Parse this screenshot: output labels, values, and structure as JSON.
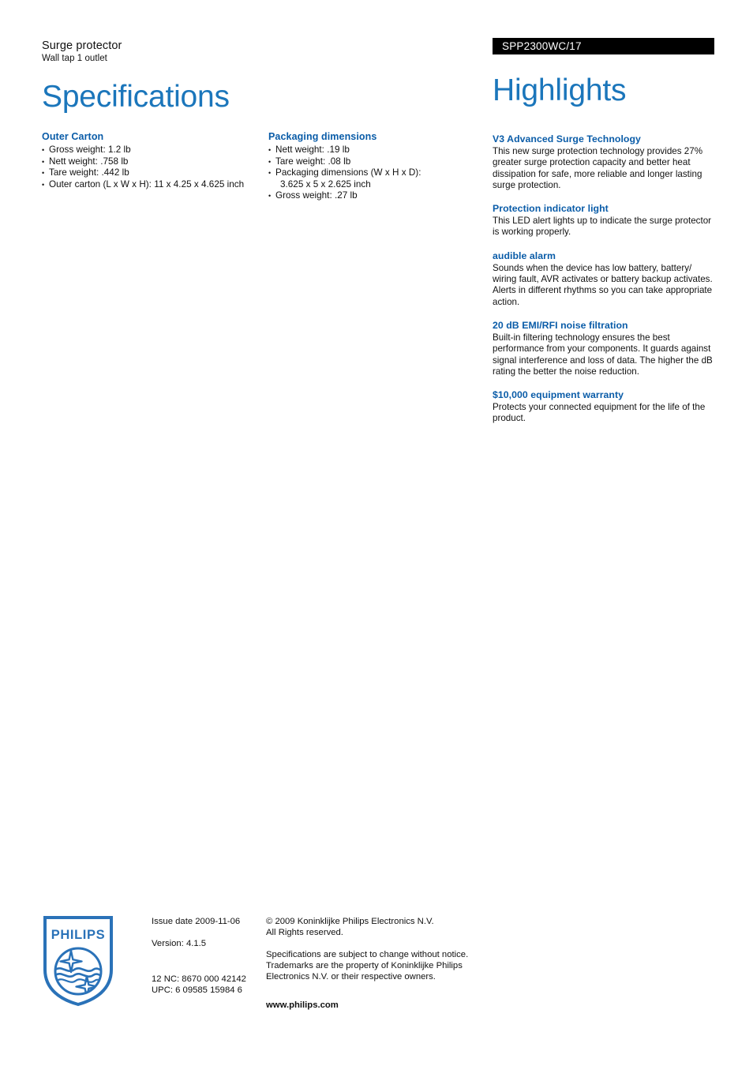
{
  "document": {
    "product_type": "Surge protector",
    "product_subtitle": "Wall tap 1 outlet",
    "model_number": "SPP2300WC/17",
    "specifications_title": "Specifications",
    "highlights_title": "Highlights"
  },
  "specifications": {
    "groups": [
      {
        "heading": "Outer Carton",
        "items": [
          {
            "text": "Gross weight: 1.2 lb",
            "cont": ""
          },
          {
            "text": "Nett weight: .758 lb",
            "cont": ""
          },
          {
            "text": "Tare weight: .442 lb",
            "cont": ""
          },
          {
            "text": "Outer carton (L x W x H): 11 x 4.25 x 4.625 inch",
            "cont": ""
          }
        ]
      },
      {
        "heading": "Packaging dimensions",
        "items": [
          {
            "text": "Nett weight: .19 lb",
            "cont": ""
          },
          {
            "text": "Tare weight: .08 lb",
            "cont": ""
          },
          {
            "text": "Packaging dimensions (W x H x D):",
            "cont": "3.625 x 5 x 2.625 inch"
          },
          {
            "text": "Gross weight: .27 lb",
            "cont": ""
          }
        ]
      }
    ]
  },
  "highlights": {
    "items": [
      {
        "title": "V3 Advanced Surge Technology",
        "body": "This new surge protection technology provides 27% greater surge protection capacity and better heat dissipation for safe, more reliable and longer lasting surge protection."
      },
      {
        "title": "Protection indicator light",
        "body": "This LED alert lights up to indicate the surge protector is working properly."
      },
      {
        "title": "audible alarm",
        "body": "Sounds when the device has low battery, battery/ wiring fault, AVR activates or battery backup activates. Alerts in different rhythms so you can take appropriate action."
      },
      {
        "title": "20 dB EMI/RFI noise filtration",
        "body": "Built-in filtering technology ensures the best performance from your components. It guards against signal interference and loss of data. The higher the dB rating the better the noise reduction."
      },
      {
        "title": "$10,000 equipment warranty",
        "body": "Protects your connected equipment for the life of the product."
      }
    ]
  },
  "footer": {
    "logo_wordmark": "PHILIPS",
    "issue_date": "Issue date 2009-11-06",
    "version": "Version: 4.1.5",
    "twelve_nc": "12 NC: 8670 000 42142",
    "upc": "UPC: 6 09585 15984 6",
    "copyright_line1": "© 2009 Koninklijke Philips Electronics N.V.",
    "copyright_line2": "All Rights reserved.",
    "disclaimer_line1": "Specifications are subject to change without notice.",
    "disclaimer_line2": "Trademarks are the property of Koninklijke Philips",
    "disclaimer_line3": "Electronics N.V. or their respective owners.",
    "website": "www.philips.com"
  },
  "colors": {
    "heading_blue": "#0a5ca8",
    "title_blue": "#1b76bb",
    "banner_black": "#000000",
    "text_black": "#111111"
  }
}
